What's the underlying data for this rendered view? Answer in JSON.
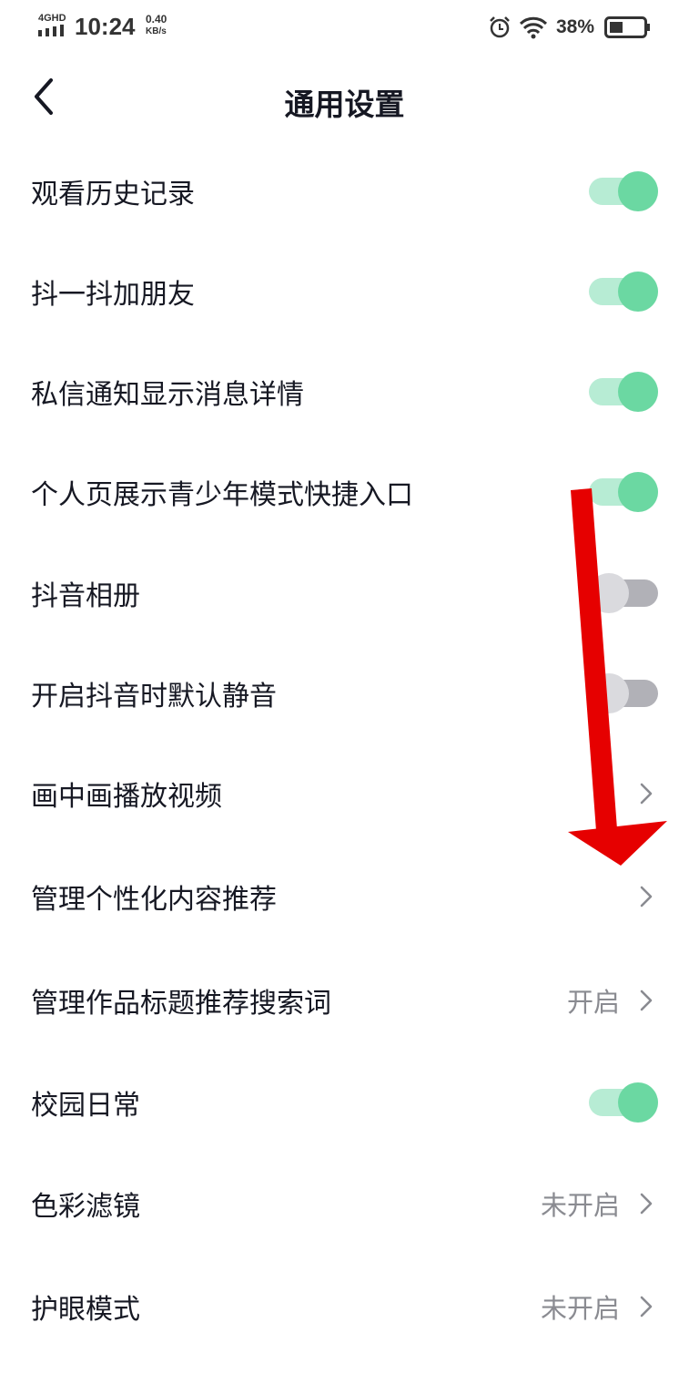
{
  "status_bar": {
    "network": "4GHD",
    "time": "10:24",
    "speed_value": "0.40",
    "speed_unit": "KB/s",
    "battery": "38%",
    "battery_level": 0.38,
    "icons": [
      "signal-icon",
      "alarm-icon",
      "wifi-icon",
      "battery-icon"
    ]
  },
  "header": {
    "title": "通用设置",
    "back_icon": "chevron-left-icon"
  },
  "settings": [
    {
      "label": "观看历史记录",
      "type": "toggle",
      "on": true
    },
    {
      "label": "抖一抖加朋友",
      "type": "toggle",
      "on": true
    },
    {
      "label": "私信通知显示消息详情",
      "type": "toggle",
      "on": true
    },
    {
      "label": "个人页展示青少年模式快捷入口",
      "type": "toggle",
      "on": true
    },
    {
      "label": "抖音相册",
      "type": "toggle",
      "on": false
    },
    {
      "label": "开启抖音时默认静音",
      "type": "toggle",
      "on": false
    },
    {
      "label": "画中画播放视频",
      "type": "link",
      "value": ""
    },
    {
      "label": "管理个性化内容推荐",
      "type": "link",
      "value": ""
    },
    {
      "label": "管理作品标题推荐搜索词",
      "type": "link",
      "value": "开启"
    },
    {
      "label": "校园日常",
      "type": "toggle",
      "on": true
    },
    {
      "label": "色彩滤镜",
      "type": "link",
      "value": "未开启"
    },
    {
      "label": "护眼模式",
      "type": "link",
      "value": "未开启"
    }
  ],
  "colors": {
    "toggle_on": "#6bd8a2",
    "toggle_on_track": "#b7ecd4",
    "toggle_off": "#b1b1b7",
    "annotation_arrow": "#e60000"
  }
}
